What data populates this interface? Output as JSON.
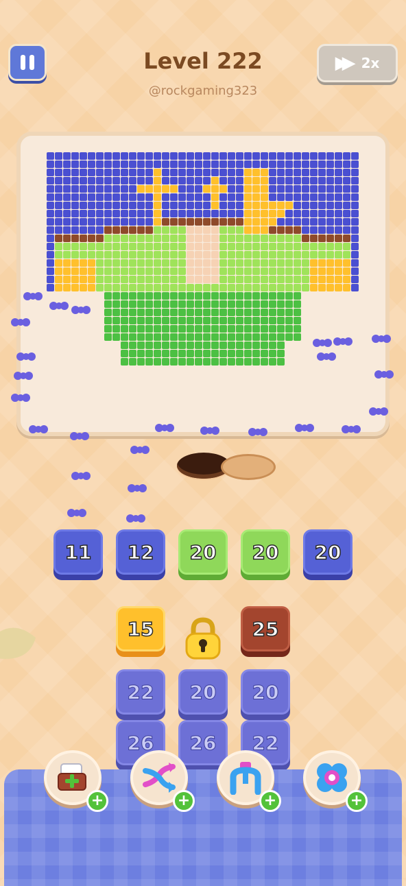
{
  "hud": {
    "level": "Level 222",
    "username": "@rockgaming323",
    "speed_label": "2x"
  },
  "icons": {
    "pause": "pause-icon",
    "speed": "fast-forward-icon",
    "lock": "padlock-icon",
    "boosters": [
      "add-box-booster-icon",
      "shuffle-arrows-booster-icon",
      "magnet-claw-booster-icon",
      "ring-booster-icon"
    ]
  },
  "queue": [
    {
      "value": "11",
      "color": "#5561d6"
    },
    {
      "value": "12",
      "color": "#5561d6"
    },
    {
      "value": "20",
      "color": "#8fd85a"
    },
    {
      "value": "20",
      "color": "#8fd85a"
    },
    {
      "value": "20",
      "color": "#5561d6"
    }
  ],
  "grid": {
    "row1": [
      {
        "value": "15",
        "color": "#ffc02c"
      },
      {
        "value": "",
        "locked": true
      },
      {
        "value": "25",
        "color": "#a3452e"
      }
    ],
    "row2": [
      "22",
      "20",
      "20"
    ],
    "row3": [
      "26",
      "26",
      "22"
    ]
  },
  "colors": {
    "blue": "#5561d6",
    "green": "#8fd85a",
    "yellow": "#ffc02c",
    "brown": "#a3452e",
    "art_bg": "#4a4fd1",
    "art_moth_light": "#9fe35a",
    "art_moth_dark": "#4cc043",
    "art_trim": "#8e4a2a",
    "art_cream": "#f6d2b4",
    "ant": "#6a5fe0"
  }
}
